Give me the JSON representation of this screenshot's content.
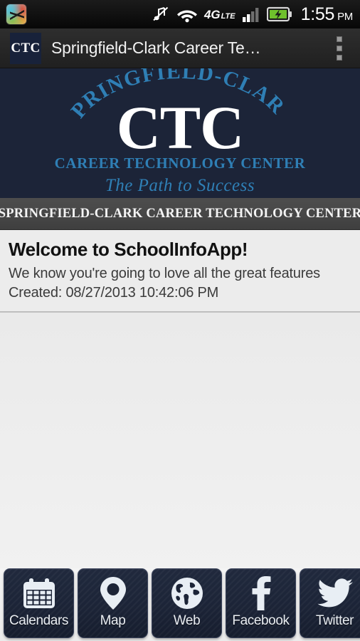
{
  "status_bar": {
    "time": "1:55",
    "ampm": "PM",
    "network_label": "4G",
    "network_sublabel": "LTE",
    "icons": [
      "notification-app-icon",
      "silent-mode-icon",
      "wifi-icon",
      "4g-lte-icon",
      "cell-signal-icon",
      "battery-charging-icon"
    ],
    "signal_bars": 4,
    "signal_bars_active": 2,
    "wifi_strength": 3,
    "battery_charging": true
  },
  "action_bar": {
    "app_icon_text": "CTC",
    "title": "Springfield-Clark Career Te…",
    "overflow_label": "More options"
  },
  "logo_banner": {
    "arc_text": "SPRINGFIELD-CLARK",
    "monogram": "CTC",
    "subtitle": "CAREER TECHNOLOGY CENTER",
    "tagline": "The Path to Success",
    "background_color": "#1c2438",
    "accent_color": "#2f7fb5",
    "monogram_color": "#ffffff"
  },
  "school_bar": {
    "title": "SPRINGFIELD-CLARK CAREER TECHNOLOGY CENTER",
    "background_color": "#474747"
  },
  "welcome": {
    "title": "Welcome to SchoolInfoApp!",
    "line1": "We know you're going to love all the great features",
    "line2": "Created: 08/27/2013 10:42:06 PM"
  },
  "bottom_nav": {
    "items": [
      {
        "label": "Calendars",
        "icon": "calendar-icon"
      },
      {
        "label": "Map",
        "icon": "map-pin-icon"
      },
      {
        "label": "Web",
        "icon": "globe-icon"
      },
      {
        "label": "Facebook",
        "icon": "facebook-icon"
      },
      {
        "label": "Twitter",
        "icon": "twitter-bird-icon"
      }
    ],
    "button_color": "#1c2437",
    "label_color": "#e9edf2"
  }
}
